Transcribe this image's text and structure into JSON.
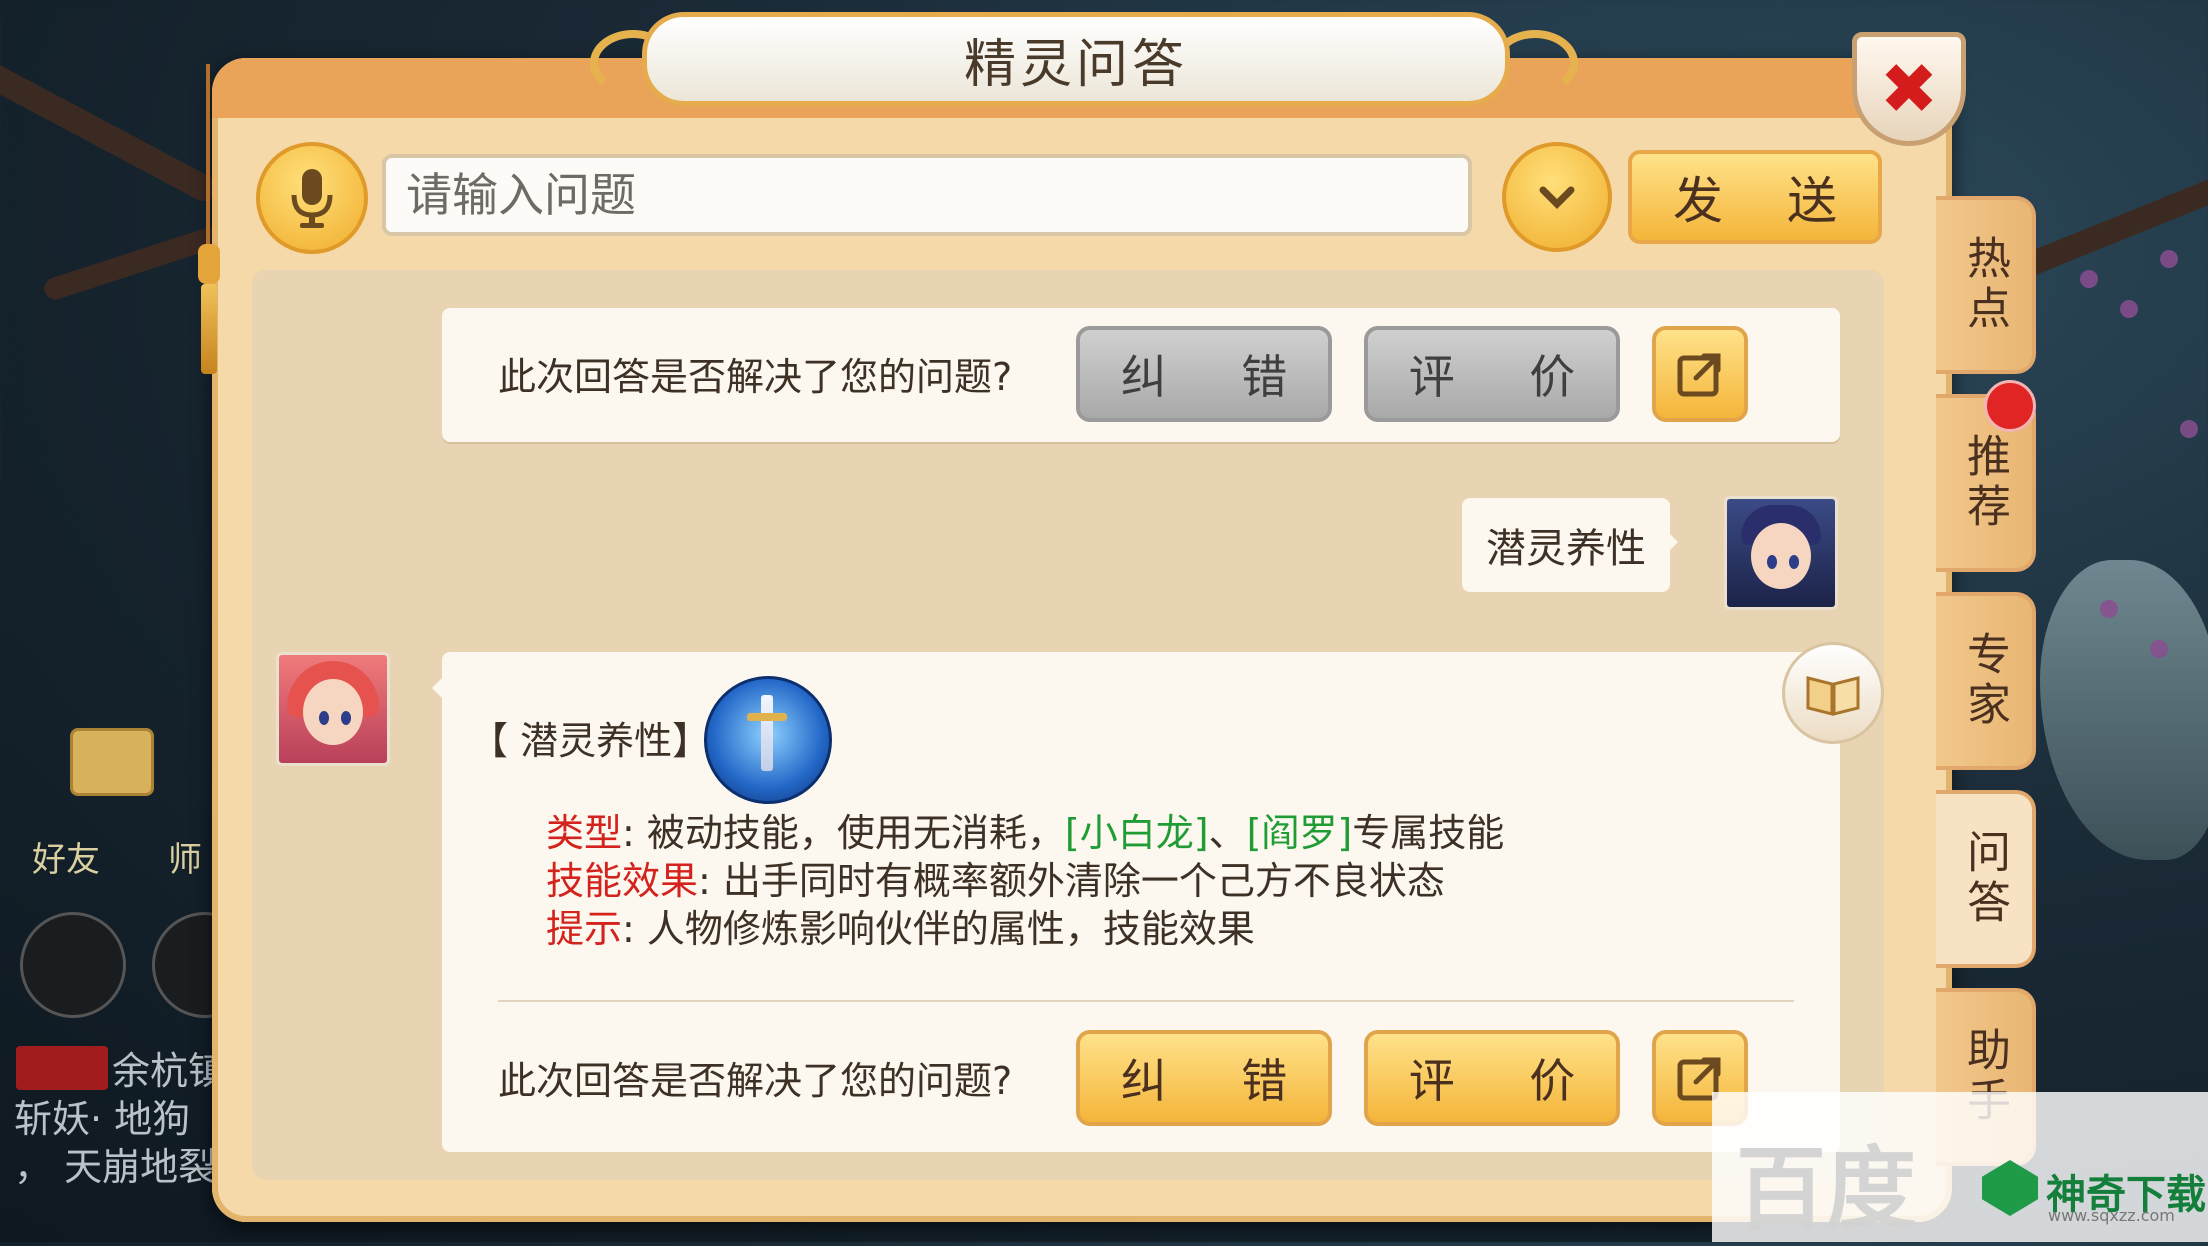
{
  "panel": {
    "title": "精灵问答",
    "close_symbol": "✖"
  },
  "input_bar": {
    "placeholder": "请输入问题",
    "send_label": "发 送"
  },
  "feedback_top": {
    "question": "此次回答是否解决了您的问题?",
    "correct_label": "纠 错",
    "rate_label": "评 价"
  },
  "user_message": {
    "text": "潜灵养性"
  },
  "answer": {
    "skill_name": "【 潜灵养性】",
    "type_label": "类型",
    "type_text_1": "被动技能，使用无消耗，",
    "type_tag_1": "[小白龙]",
    "type_sep": "、",
    "type_tag_2": "[阎罗]",
    "type_text_2": "专属技能",
    "effect_label": "技能效果",
    "effect_text": "出手同时有概率额外清除一个己方不良状态",
    "tip_label": "提示",
    "tip_text": "人物修炼影响伙伴的属性，技能效果",
    "colon": ": "
  },
  "feedback_bottom": {
    "question": "此次回答是否解决了您的问题?",
    "correct_label": "纠 错",
    "rate_label": "评 价"
  },
  "side_tabs": [
    {
      "label": "热点",
      "active": false
    },
    {
      "label": "推荐",
      "active": false,
      "badge": true
    },
    {
      "label": "专家",
      "active": false
    },
    {
      "label": "问答",
      "active": true
    },
    {
      "label": "助手",
      "active": false
    }
  ],
  "hud": {
    "friend_label": "好友",
    "master_label": "师",
    "chat_line_1": "余杭镇",
    "chat_line_2": "斩妖· 地狗",
    "chat_line_3": "， 天崩地裂"
  },
  "watermark": {
    "baidu": "百度",
    "brand": "神奇下载",
    "url": "www.sqxzz.com"
  },
  "colors": {
    "panel_bg": "#f5d9a8",
    "gold_button": "#f4b53a",
    "grey_button": "#a8a9a8",
    "label_red": "#d4231d",
    "tag_green": "#1f9d34"
  }
}
